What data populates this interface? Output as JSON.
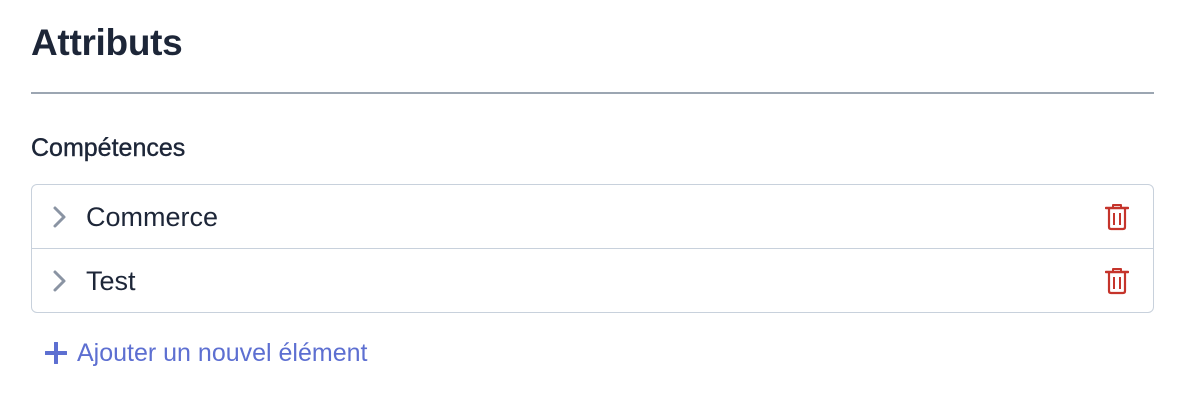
{
  "header": {
    "title": "Attributs"
  },
  "section": {
    "label": "Compétences"
  },
  "list": {
    "items": [
      {
        "label": "Commerce"
      },
      {
        "label": "Test"
      }
    ]
  },
  "actions": {
    "add_label": "Ajouter un nouvel élément"
  },
  "colors": {
    "text": "#1d2638",
    "divider": "#9ca6b2",
    "border": "#c8d1dc",
    "chevron": "#8a94a3",
    "delete": "#c5342b",
    "accent": "#5d6fd1"
  },
  "icons": {
    "chevron": "chevron-right-icon",
    "delete": "trash-icon",
    "add": "plus-icon"
  }
}
